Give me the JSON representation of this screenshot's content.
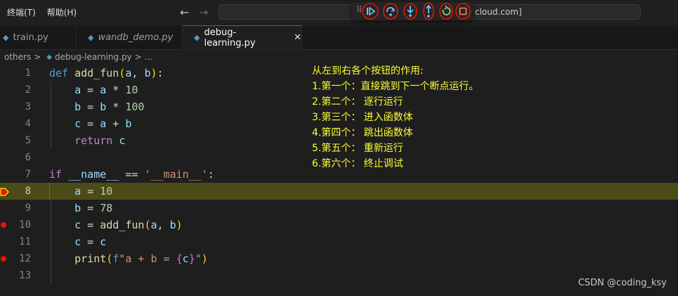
{
  "menu": [
    "终端(T)",
    "帮助(H)"
  ],
  "nav": {
    "back_icon": "arrow-left-icon",
    "forward_icon": "arrow-right-icon"
  },
  "command_center_text": "cloud.com]",
  "debug_toolbar": {
    "highlight_color": "#e51400",
    "buttons": [
      {
        "name": "continue-button",
        "icon": "continue-icon"
      },
      {
        "name": "step-over-button",
        "icon": "step-over-icon"
      },
      {
        "name": "step-into-button",
        "icon": "step-into-icon"
      },
      {
        "name": "step-out-button",
        "icon": "step-out-icon"
      },
      {
        "name": "restart-button",
        "icon": "restart-icon"
      },
      {
        "name": "stop-button",
        "icon": "stop-icon"
      }
    ]
  },
  "tabs": [
    {
      "label": "train.py",
      "active": false,
      "italic": false
    },
    {
      "label": "wandb_demo.py",
      "active": false,
      "italic": true
    },
    {
      "label": "debug-learning.py",
      "active": true,
      "italic": false,
      "close": "✕"
    }
  ],
  "breadcrumb": {
    "folder": "others",
    "sep": ">",
    "file": "debug-learning.py",
    "tail": "> ..."
  },
  "code_lines": [
    "def add_fun(a, b):",
    "    a = a * 10",
    "    b = b * 100",
    "    c = a + b",
    "    return c",
    "",
    "if __name__ == '__main__':",
    "    a = 10",
    "    b = 78",
    "    c = add_fun(a, b)",
    "    c = c",
    "    print(f\"a + b = {c}\")",
    ""
  ],
  "line_numbers": [
    "1",
    "2",
    "3",
    "4",
    "5",
    "6",
    "7",
    "8",
    "9",
    "10",
    "11",
    "12",
    "13"
  ],
  "current_line": 8,
  "breakpoint_lines": [
    8,
    10,
    12
  ],
  "annotation": {
    "title": "从左到右各个按钮的作用:",
    "items": [
      "1.第一个：直接跳到下一个断点运行。",
      "2.第二个： 逐行运行",
      "3.第三个： 进入函数体",
      "4.第四个： 跳出函数体",
      "5.第五个： 重新运行",
      "6.第六个： 终止调试"
    ]
  },
  "watermark": "CSDN @coding_ksy",
  "colors": {
    "current_line_bg": "#4b4b18",
    "annotation_text": "#fdfd34",
    "breakpoint": "#e51400"
  }
}
